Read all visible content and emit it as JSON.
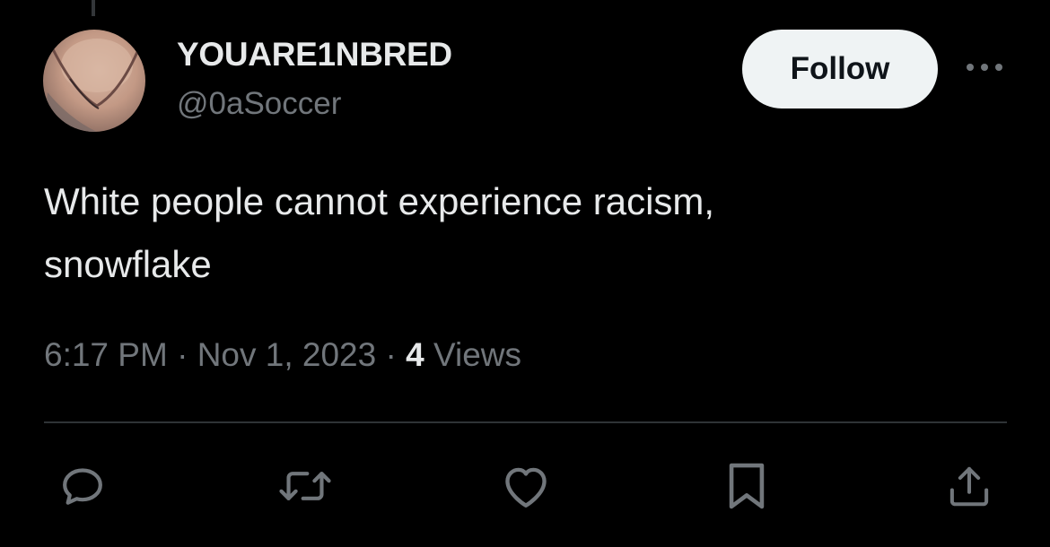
{
  "tweet": {
    "author": {
      "display_name": "YOUARE1NBRED",
      "handle": "@0aSoccer"
    },
    "text": "White people cannot experience racism,\nsnowflake",
    "time": "6:17 PM",
    "separator": "·",
    "date": "Nov 1, 2023",
    "views_count": "4",
    "views_label": "Views"
  },
  "buttons": {
    "follow_label": "Follow"
  },
  "icons": {
    "more": "ellipsis-icon",
    "reply": "speech-bubble-icon",
    "retweet": "retweet-arrows-icon",
    "like": "heart-icon",
    "bookmark": "bookmark-icon",
    "share": "share-upload-icon"
  },
  "colors": {
    "background": "#000000",
    "primary_text": "#e7e9ea",
    "secondary_text": "#71767b",
    "follow_button_bg": "#eff3f4",
    "follow_button_text": "#0f1419",
    "divider": "#2f3336"
  }
}
